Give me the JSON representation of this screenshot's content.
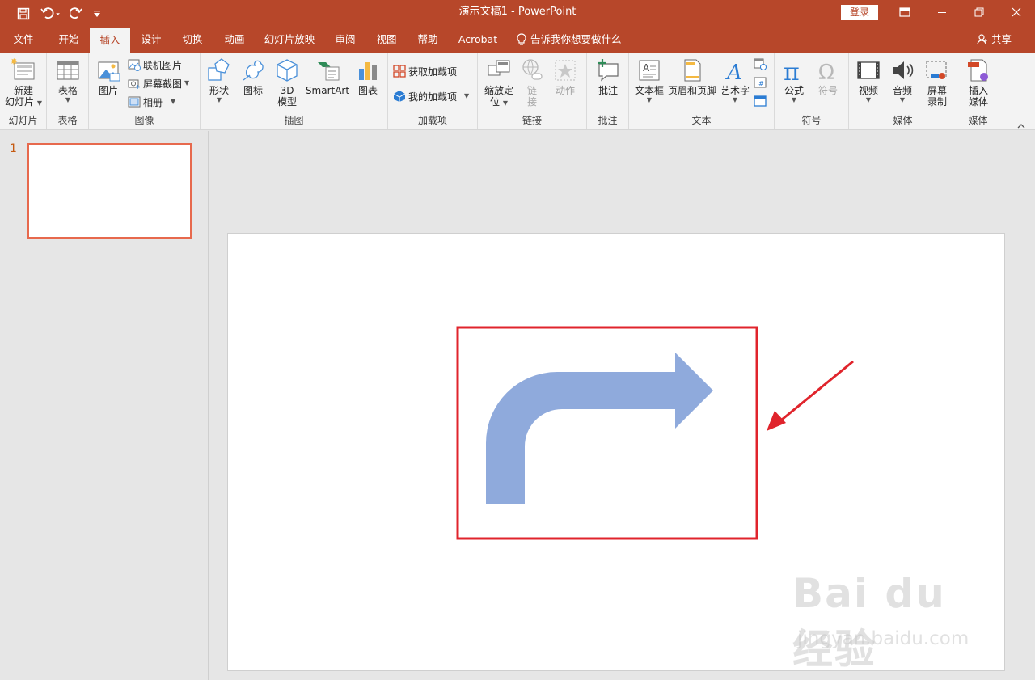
{
  "colors": {
    "accent": "#b7472a",
    "ribbon_bg": "#f3f3f3",
    "arrow_fill": "#8faadc",
    "highlight_red": "#e0242c",
    "thumb_border": "#e7694d"
  },
  "titlebar": {
    "title": "演示文稿1  -  PowerPoint",
    "login_label": "登录",
    "qat_icons": [
      "save-icon",
      "undo-icon",
      "redo-icon",
      "customize-icon"
    ]
  },
  "tabs": [
    {
      "label": "文件",
      "active": false
    },
    {
      "label": "开始",
      "active": false
    },
    {
      "label": "插入",
      "active": true
    },
    {
      "label": "设计",
      "active": false
    },
    {
      "label": "切换",
      "active": false
    },
    {
      "label": "动画",
      "active": false
    },
    {
      "label": "幻灯片放映",
      "active": false
    },
    {
      "label": "审阅",
      "active": false
    },
    {
      "label": "视图",
      "active": false
    },
    {
      "label": "帮助",
      "active": false
    },
    {
      "label": "Acrobat",
      "active": false
    }
  ],
  "tell_me": "告诉我你想要做什么",
  "share_label": "共享",
  "ribbon": {
    "groups": {
      "slides": "幻灯片",
      "tables": "表格",
      "images": "图像",
      "illustrations": "插图",
      "addins": "加载项",
      "links": "链接",
      "comments": "批注",
      "text": "文本",
      "symbols": "符号",
      "media": "媒体",
      "media2": "媒体"
    },
    "buttons": {
      "new_slide_1": "新建",
      "new_slide_2": "幻灯片",
      "table": "表格",
      "picture": "图片",
      "online_picture": "联机图片",
      "screenshot": "屏幕截图",
      "album": "相册",
      "shapes": "形状",
      "icons": "图标",
      "model_1": "3D",
      "model_2": "模型",
      "smartart": "SmartArt",
      "chart": "图表",
      "get_addins": "获取加载项",
      "my_addins": "我的加载项",
      "zoom_1": "缩放定",
      "zoom_2": "位",
      "link_1": "链",
      "link_2": "接",
      "action": "动作",
      "comment": "批注",
      "textbox": "文本框",
      "header_footer": "页眉和页脚",
      "wordart": "艺术字",
      "equation": "公式",
      "symbol": "符号",
      "video": "视频",
      "audio": "音频",
      "screen_rec_1": "屏幕",
      "screen_rec_2": "录制",
      "insert_media_1": "插入",
      "insert_media_2": "媒体"
    }
  },
  "slide_pane": {
    "slide_number": "1"
  },
  "watermark": {
    "brand": "Bai du 经验",
    "url": "jingyan.baidu.com"
  }
}
